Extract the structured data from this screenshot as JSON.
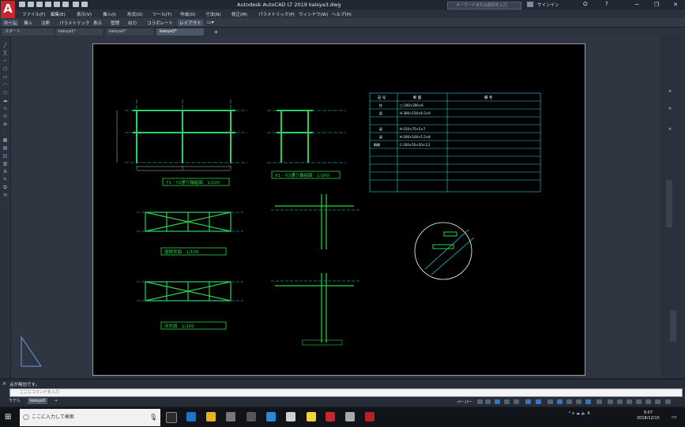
{
  "app": {
    "title": "Autodesk AutoCAD LT 2019   kaisya3.dwg",
    "search_placeholder": "キーワードまたは語句を入力",
    "signin": "サインイン"
  },
  "menu": [
    "ファイル(F)",
    "編集(E)",
    "表示(V)",
    "挿入(I)",
    "形式(O)",
    "ツール(T)",
    "作成(D)",
    "寸法(N)",
    "修正(M)",
    "パラメトリック(P)",
    "ウィンドウ(W)",
    "ヘルプ(H)"
  ],
  "ribbon_tabs": [
    "ホーム",
    "挿入",
    "注釈",
    "パラメトリック",
    "表示",
    "管理",
    "出力",
    "コラボレート",
    "レイアウト"
  ],
  "doc_tabs": [
    "スタート",
    "kaisya1*",
    "kaisya2*",
    "kaisya3*"
  ],
  "drawing": {
    "title1": "Y1 - Y2通り軸組図　1/100",
    "title2": "X1 - X3通り軸組図　1/100",
    "title3": "屋根伏図　1/100",
    "title4": "床伏図　1/100",
    "table_header": [
      "記 号",
      "断 面",
      "備 考"
    ],
    "table_rows": [
      [
        "柱",
        "□-200×200×6",
        ""
      ],
      [
        "梁",
        "H-300×150×6.5×9",
        ""
      ],
      [
        "梁",
        "H-150×75×5×7",
        ""
      ],
      [
        "梁",
        "H-200×100×5.5×8",
        ""
      ],
      [
        "胴縁",
        "C-100×50×20×3.2",
        ""
      ]
    ]
  },
  "command": {
    "history": "点が無効です。",
    "placeholder": "ここにコマンドを入力"
  },
  "layout_tabs": [
    "モデル",
    "kaisya3",
    "+"
  ],
  "status": {
    "paper": "ペーパー"
  },
  "taskbar": {
    "search_placeholder": "ここに入力して検索",
    "time": "9:07",
    "date": "2018/12/15"
  },
  "colors": {
    "green": "#2bd14a",
    "cyan": "#22d6e6",
    "white": "#ffffff",
    "paper": "#000000",
    "accent": "#c8252c"
  }
}
